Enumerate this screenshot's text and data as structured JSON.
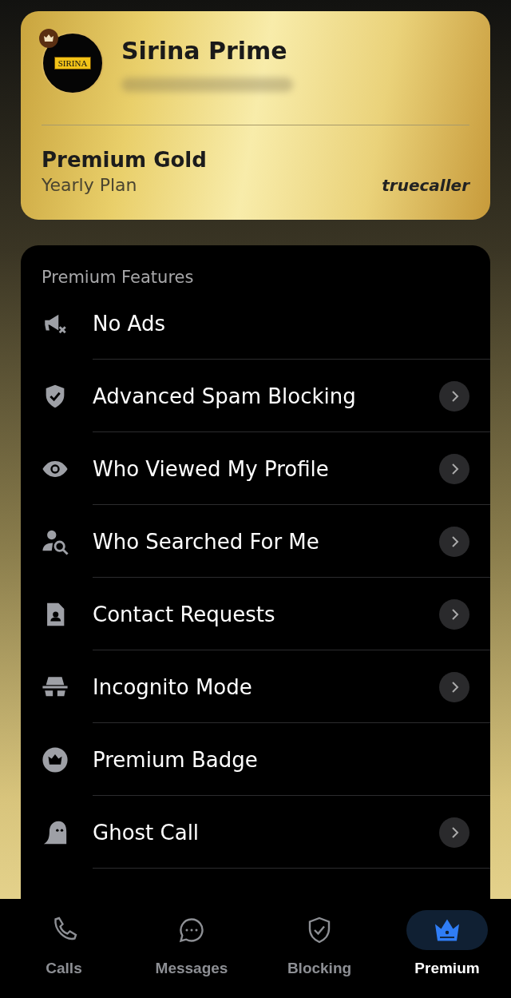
{
  "plan_card": {
    "avatar_text": "SIRINA",
    "name": "Sirina Prime",
    "plan": "Premium Gold",
    "period": "Yearly Plan",
    "brand": "truecaller"
  },
  "features": {
    "title": "Premium Features",
    "items": [
      {
        "label": "No Ads",
        "chevron": false
      },
      {
        "label": "Advanced Spam Blocking",
        "chevron": true
      },
      {
        "label": "Who Viewed My Profile",
        "chevron": true
      },
      {
        "label": "Who Searched For Me",
        "chevron": true
      },
      {
        "label": "Contact Requests",
        "chevron": true
      },
      {
        "label": "Incognito Mode",
        "chevron": true
      },
      {
        "label": "Premium Badge",
        "chevron": false
      },
      {
        "label": "Ghost Call",
        "chevron": true
      }
    ]
  },
  "nav": [
    {
      "label": "Calls",
      "selected": false
    },
    {
      "label": "Messages",
      "selected": false
    },
    {
      "label": "Blocking",
      "selected": false
    },
    {
      "label": "Premium",
      "selected": true
    }
  ]
}
